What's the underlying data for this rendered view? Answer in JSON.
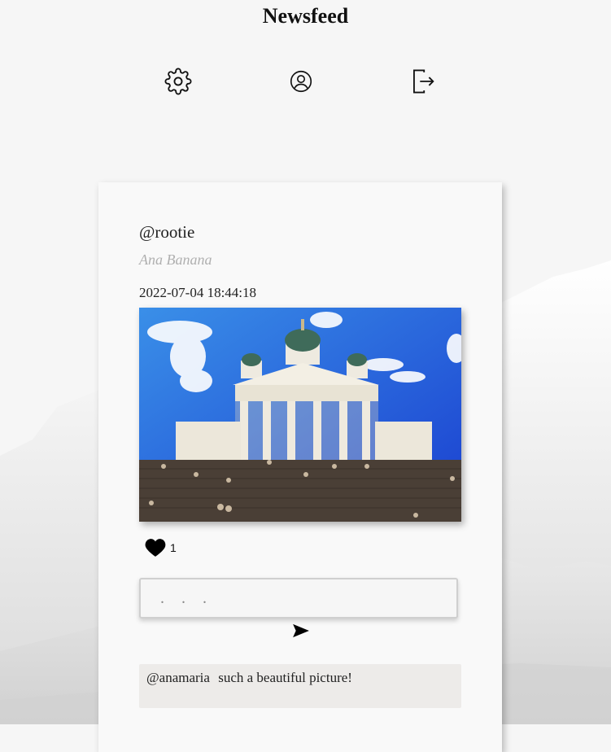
{
  "header": {
    "title": "Newsfeed"
  },
  "nav": {
    "icons": [
      "gear-icon",
      "user-circle-icon",
      "logout-icon"
    ]
  },
  "post": {
    "username": "@rootie",
    "fullname": "Ana Banana",
    "timestamp": "2022-07-04 18:44:18",
    "likes": "1",
    "comment_placeholder": ". . .",
    "comments": [
      {
        "author": "@anamaria",
        "text": "such a beautiful picture!"
      }
    ]
  },
  "colors": {
    "background": "#f6f6f6",
    "card": "#f9f9f9",
    "comment_bg": "#edebe9",
    "fullname": "#b0b0b0"
  }
}
